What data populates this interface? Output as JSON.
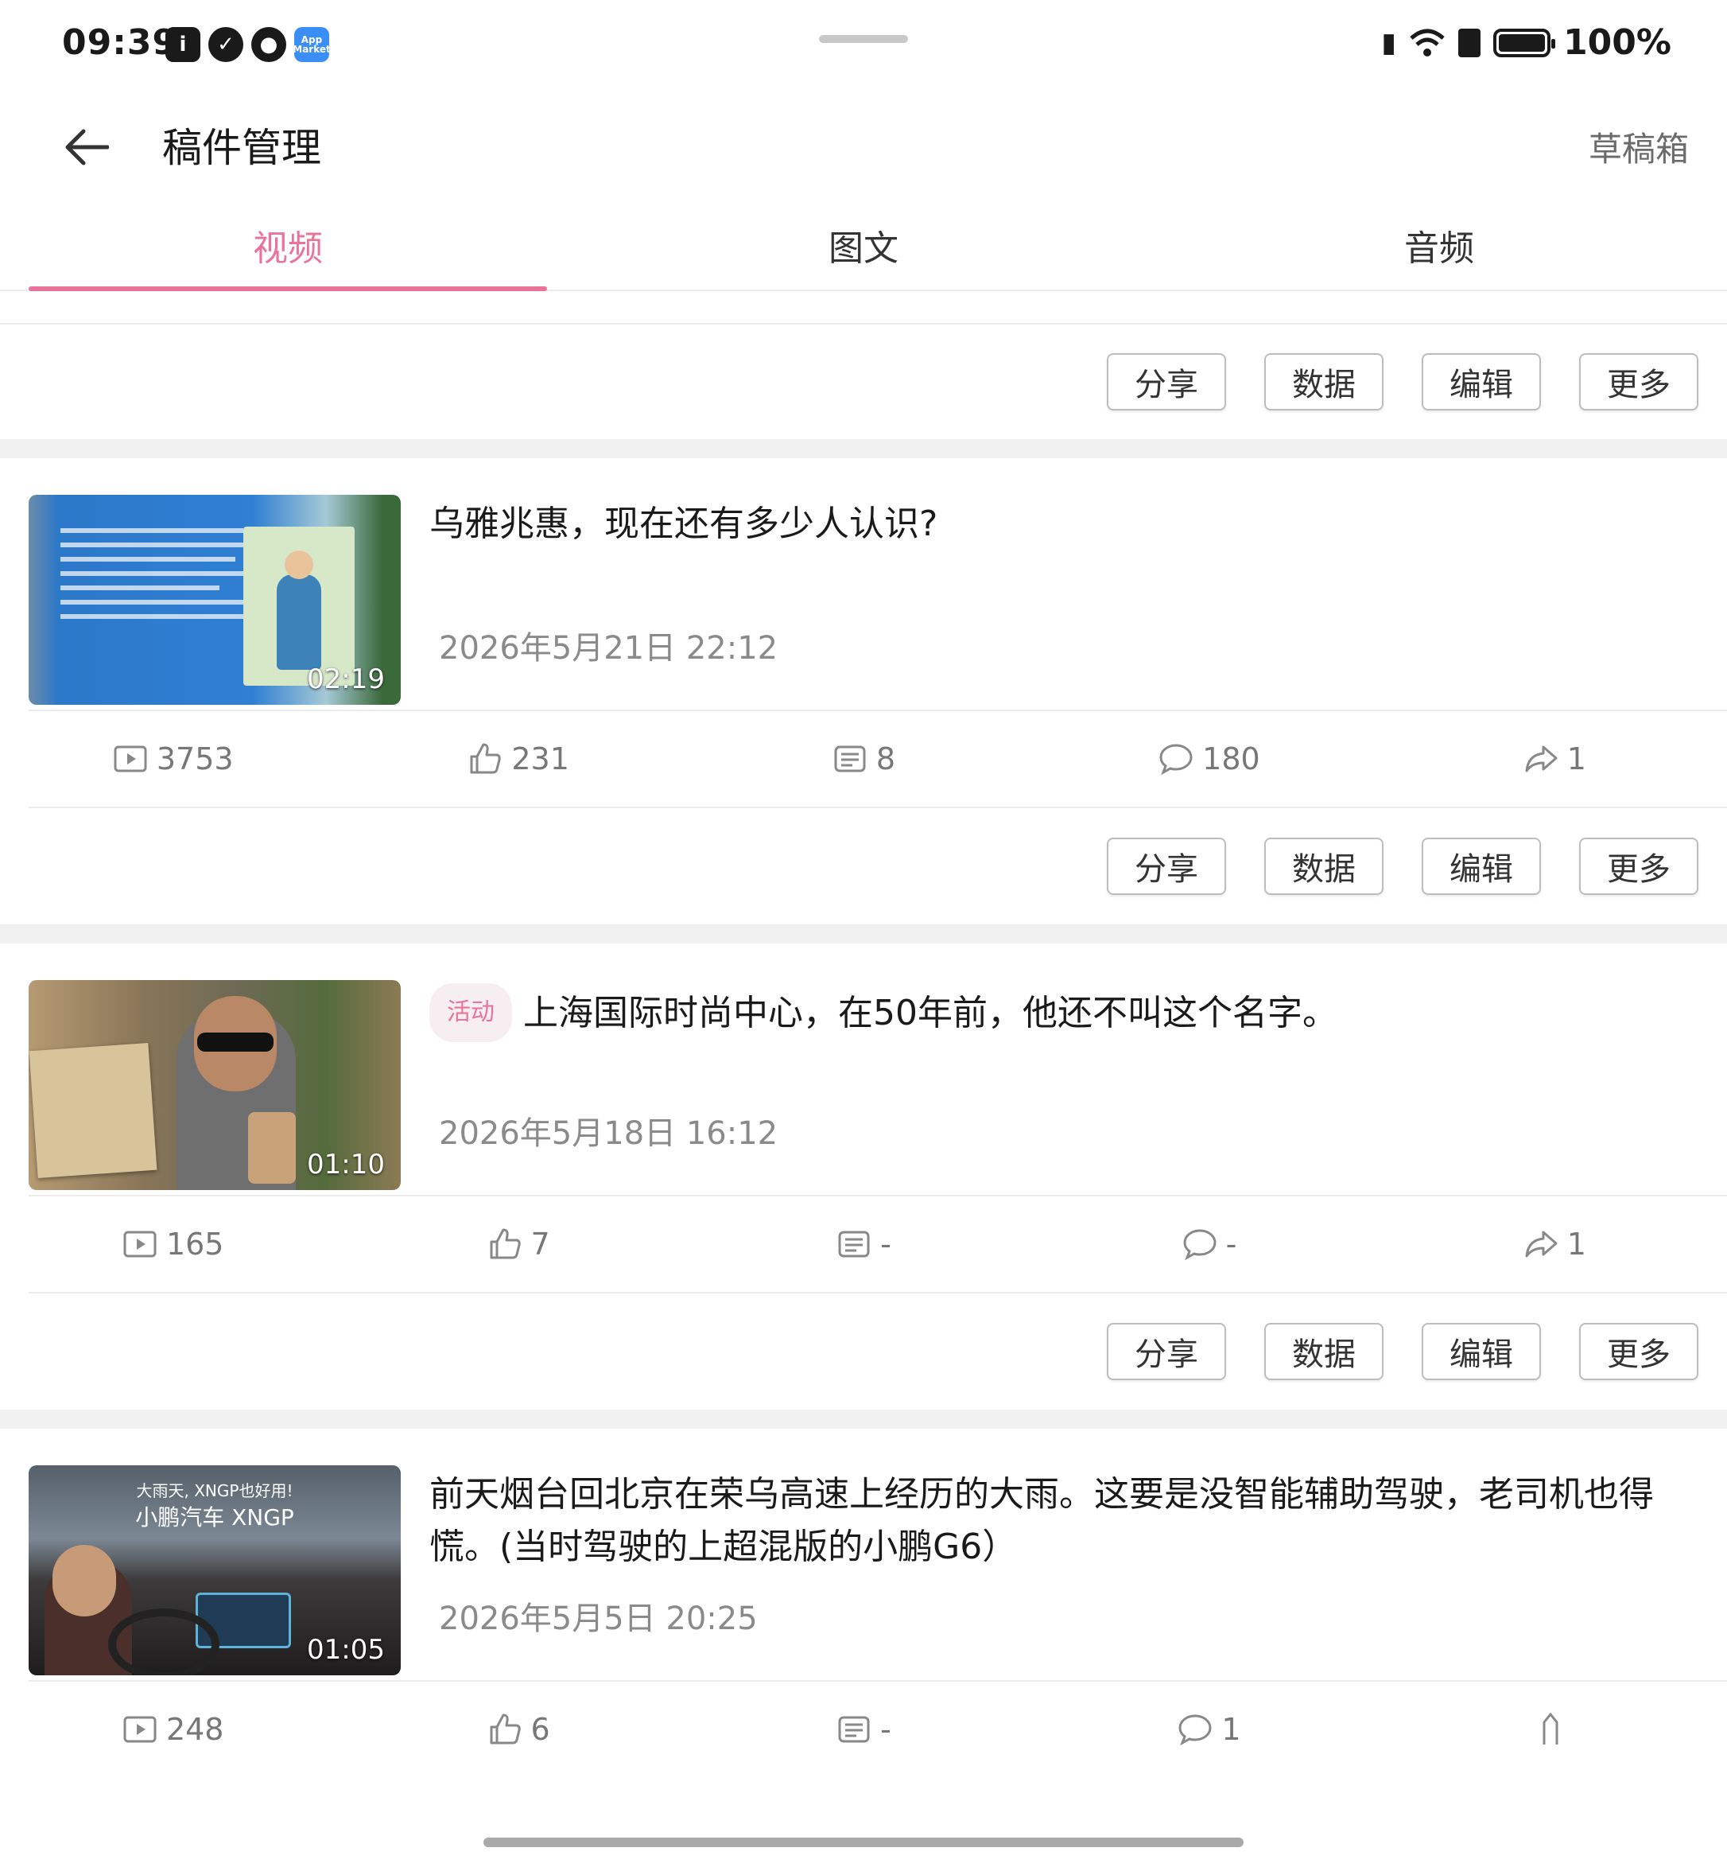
{
  "status_bar": {
    "time": "09:39",
    "battery": "100%",
    "app_icon_label": "App Market"
  },
  "header": {
    "title": "稿件管理",
    "drafts": "草稿箱"
  },
  "tabs": [
    {
      "label": "视频"
    },
    {
      "label": "图文"
    },
    {
      "label": "音频"
    }
  ],
  "actions": {
    "share": "分享",
    "data": "数据",
    "edit": "编辑",
    "more": "更多"
  },
  "colors": {
    "accent": "#e8749a"
  },
  "items": [
    {
      "title": "乌雅兆惠，现在还有多少人认识?",
      "date": "2026年5月21日 22:12",
      "duration": "02:19",
      "badge": "",
      "stats": {
        "plays": "3753",
        "likes": "231",
        "danmaku": "8",
        "comments": "180",
        "shares": "1"
      }
    },
    {
      "title": "上海国际时尚中心，在50年前，他还不叫这个名字。",
      "date": "2026年5月18日 16:12",
      "duration": "01:10",
      "badge": "活动",
      "stats": {
        "plays": "165",
        "likes": "7",
        "danmaku": "-",
        "comments": "-",
        "shares": "1"
      }
    },
    {
      "title": "前天烟台回北京在荣乌高速上经历的大雨。这要是没智能辅助驾驶，老司机也得慌。(当时驾驶的上超混版的小鹏G6）",
      "date": "2026年5月5日 20:25",
      "duration": "01:05",
      "badge": "",
      "thumb_text_1": "大雨天, XNGP也好用!",
      "thumb_text_2": "小鹏汽车 XNGP",
      "stats": {
        "plays": "248",
        "likes": "6",
        "danmaku": "-",
        "comments": "1",
        "shares": ""
      }
    }
  ]
}
